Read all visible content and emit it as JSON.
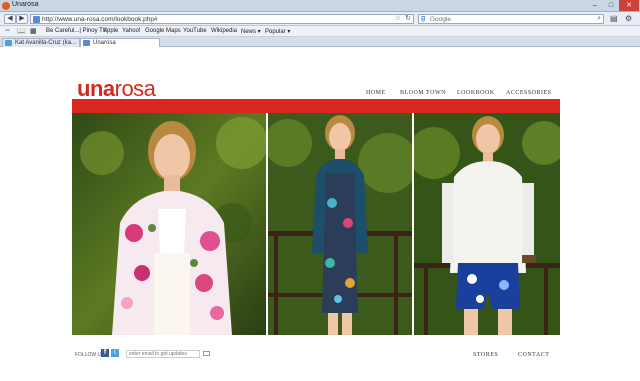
{
  "window": {
    "title": "Unarosa"
  },
  "navbar": {
    "url": "http://www.una-rosa.com/lookbook.php#",
    "search_placeholder": "Google"
  },
  "bookmarks": [
    {
      "label": "Be Careful...| Pinoy TV"
    },
    {
      "label": "Apple"
    },
    {
      "label": "Yahoo!"
    },
    {
      "label": "Google Maps"
    },
    {
      "label": "YouTube"
    },
    {
      "label": "Wikipedia"
    },
    {
      "label": "News ▾"
    },
    {
      "label": "Popular ▾"
    }
  ],
  "tabs": [
    {
      "label": "Kat Avanilla-Cruz (ka..."
    },
    {
      "label": "Unarosa"
    }
  ],
  "site": {
    "logo_left": "una",
    "logo_right": "rosa",
    "nav": [
      "HOME",
      "BLOOM TOWN",
      "LOOKBOOK",
      "ACCESSORIES"
    ],
    "follow_label": "FOLLOW US",
    "email_placeholder": "enter email to get updates",
    "footer_nav": [
      "STORES",
      "CONTACT"
    ]
  },
  "colors": {
    "brand_red": "#d9261f"
  }
}
